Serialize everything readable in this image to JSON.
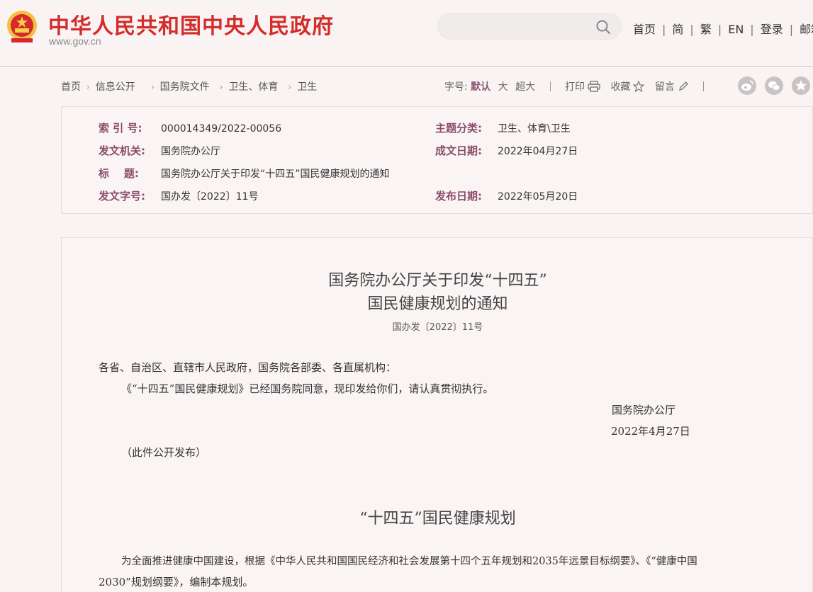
{
  "header": {
    "site_title": "中华人民共和国中央人民政府",
    "site_url": "www.gov.cn",
    "nav": [
      "首页",
      "简",
      "繁",
      "EN",
      "登录",
      "邮箱"
    ]
  },
  "breadcrumb": [
    "首页",
    "信息公开",
    "国务院文件",
    "卫生、体育",
    "卫生"
  ],
  "tools": {
    "font_label": "字号:",
    "font_default": "默认",
    "font_large": "大",
    "font_xlarge": "超大",
    "print": "打印",
    "favorite": "收藏",
    "comment": "留言"
  },
  "info": {
    "index_label": "索 引 号:",
    "index_value": "000014349/2022-00056",
    "category_label": "主题分类:",
    "category_value": "卫生、体育\\卫生",
    "issuer_label": "发文机关:",
    "issuer_value": "国务院办公厅",
    "created_label": "成文日期:",
    "created_value": "2022年04月27日",
    "title_label": "标    题:",
    "title_value": "国务院办公厅关于印发“十四五”国民健康规划的通知",
    "docno_label": "发文字号:",
    "docno_value": "国办发〔2022〕11号",
    "published_label": "发布日期:",
    "published_value": "2022年05月20日"
  },
  "document": {
    "title_line1": "国务院办公厅关于印发“十四五”",
    "title_line2": "国民健康规划的通知",
    "doc_number": "国办发〔2022〕11号",
    "salutation": "各省、自治区、直辖市人民政府，国务院各部委、各直属机构：",
    "body": "《“十四五”国民健康规划》已经国务院同意，现印发给你们，请认真贯彻执行。",
    "signer": "国务院办公厅",
    "sign_date": "2022年4月27日",
    "note": "（此件公开发布）",
    "plan_title": "“十四五”国民健康规划",
    "plan_para_line1": "为全面推进健康中国建设，根据《中华人民共和国国民经济和社会发展第十四个五年规划和2035年远景目标纲要》、《“健康中国",
    "plan_para_line2": "2030”规划纲要》，编制本规划。"
  },
  "colors": {
    "brand_red": "#d42b2b",
    "label_purple": "#8a4b6a",
    "background": "#f9f4f3"
  }
}
